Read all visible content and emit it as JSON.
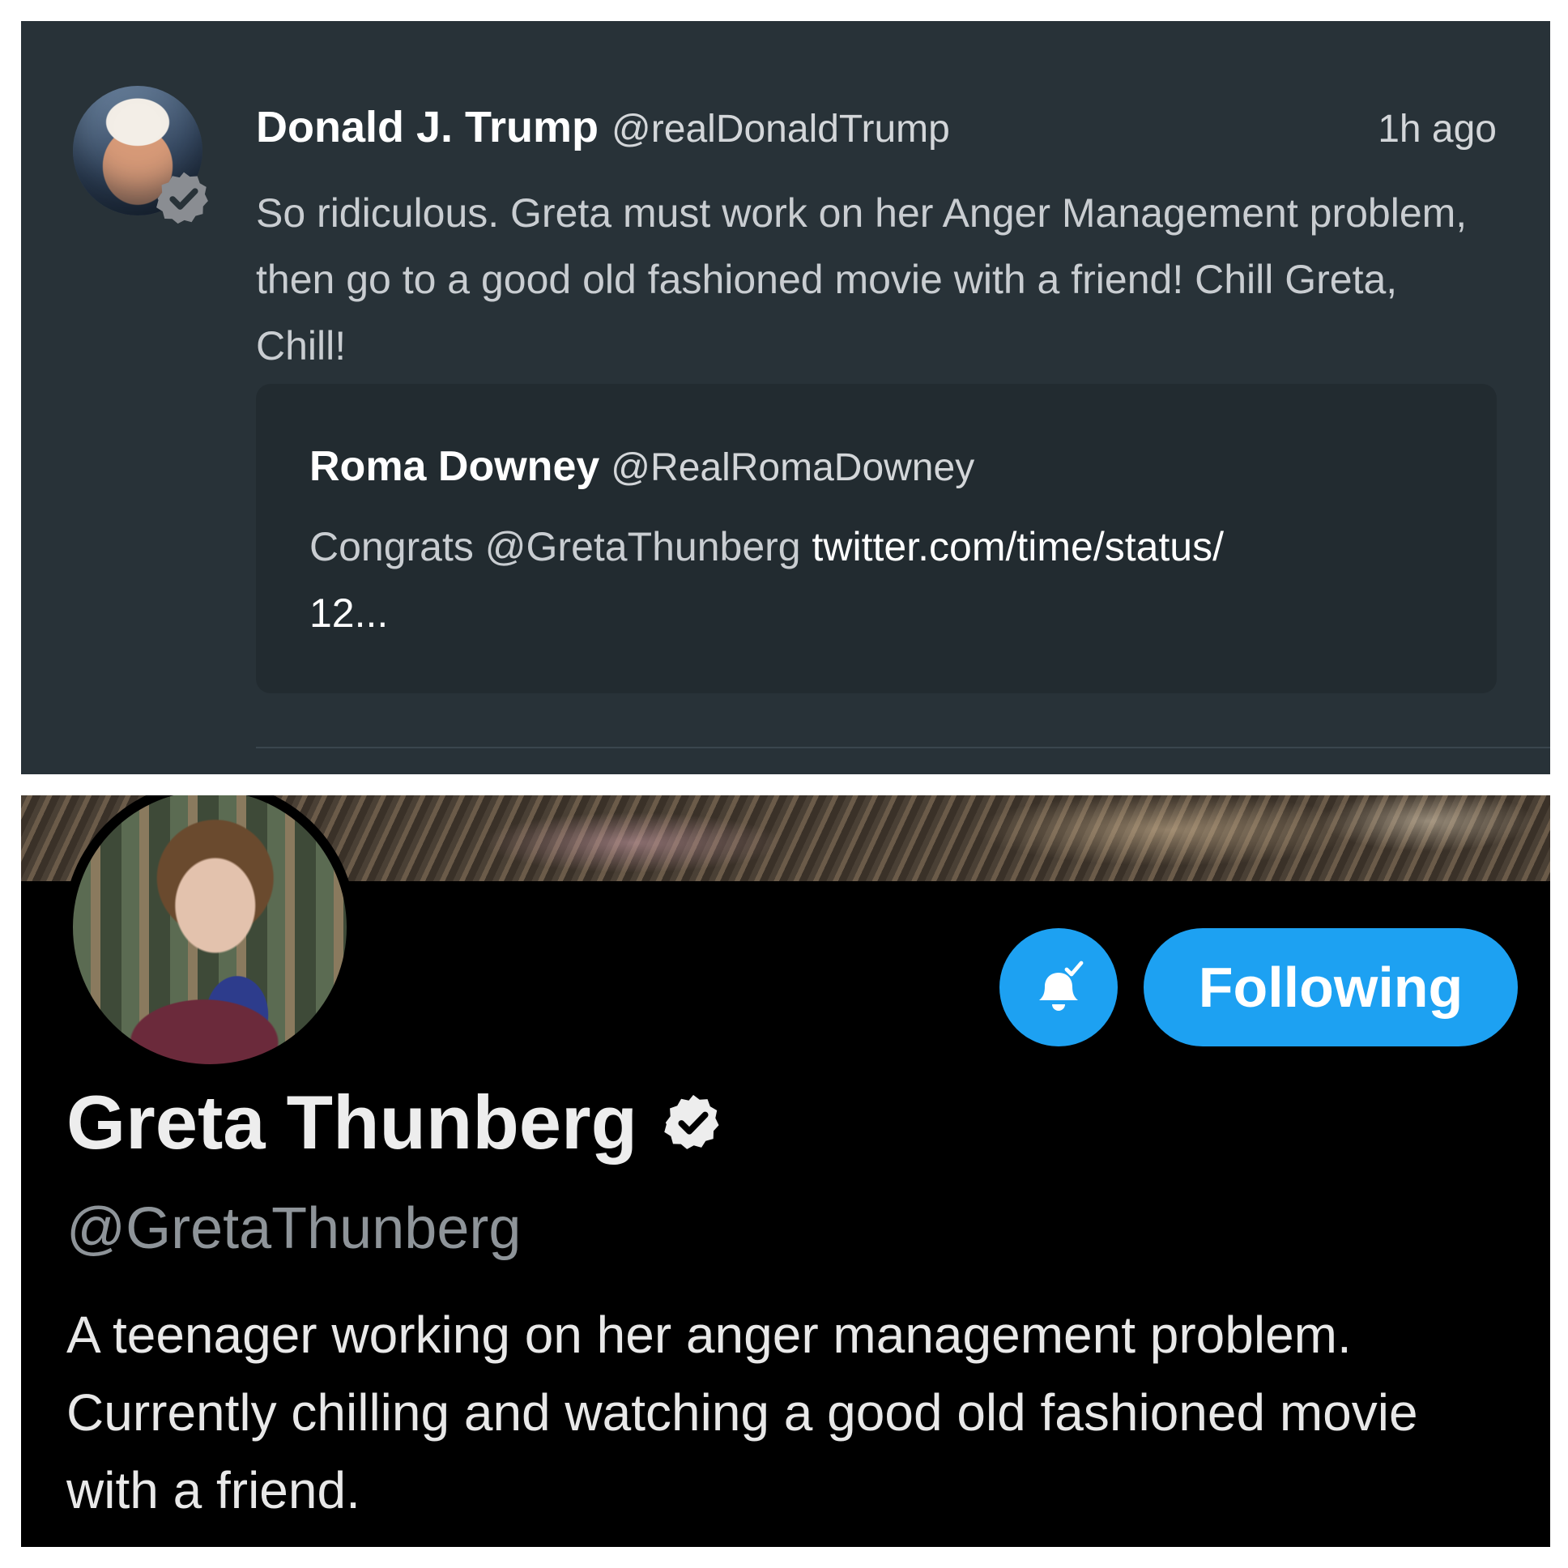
{
  "tweet": {
    "author_name": "Donald J. Trump",
    "author_handle": "@realDonaldTrump",
    "time": "1h ago",
    "text": "So ridiculous. Greta must work on her Anger Management problem, then go to a good old fashioned movie with a friend! Chill Greta, Chill!",
    "quoted": {
      "author_name": "Roma Downey",
      "author_handle": "@RealRomaDowney",
      "text": "Congrats @GretaThunberg",
      "link_text": "twitter.com/time/status/",
      "link_tail": "12..."
    }
  },
  "profile": {
    "name": "Greta Thunberg",
    "handle": "@GretaThunberg",
    "follow_label": "Following",
    "bio": "A teenager working on her anger management problem. Currently chilling and watching a good old fashioned movie with a friend."
  },
  "colors": {
    "tweet_background": "#283238",
    "quote_background": "#222b30",
    "profile_background": "#000000",
    "accent": "#1da1f2"
  },
  "icons": {
    "verified_badge": "verified-badge-icon",
    "notifications": "bell-check-icon"
  }
}
